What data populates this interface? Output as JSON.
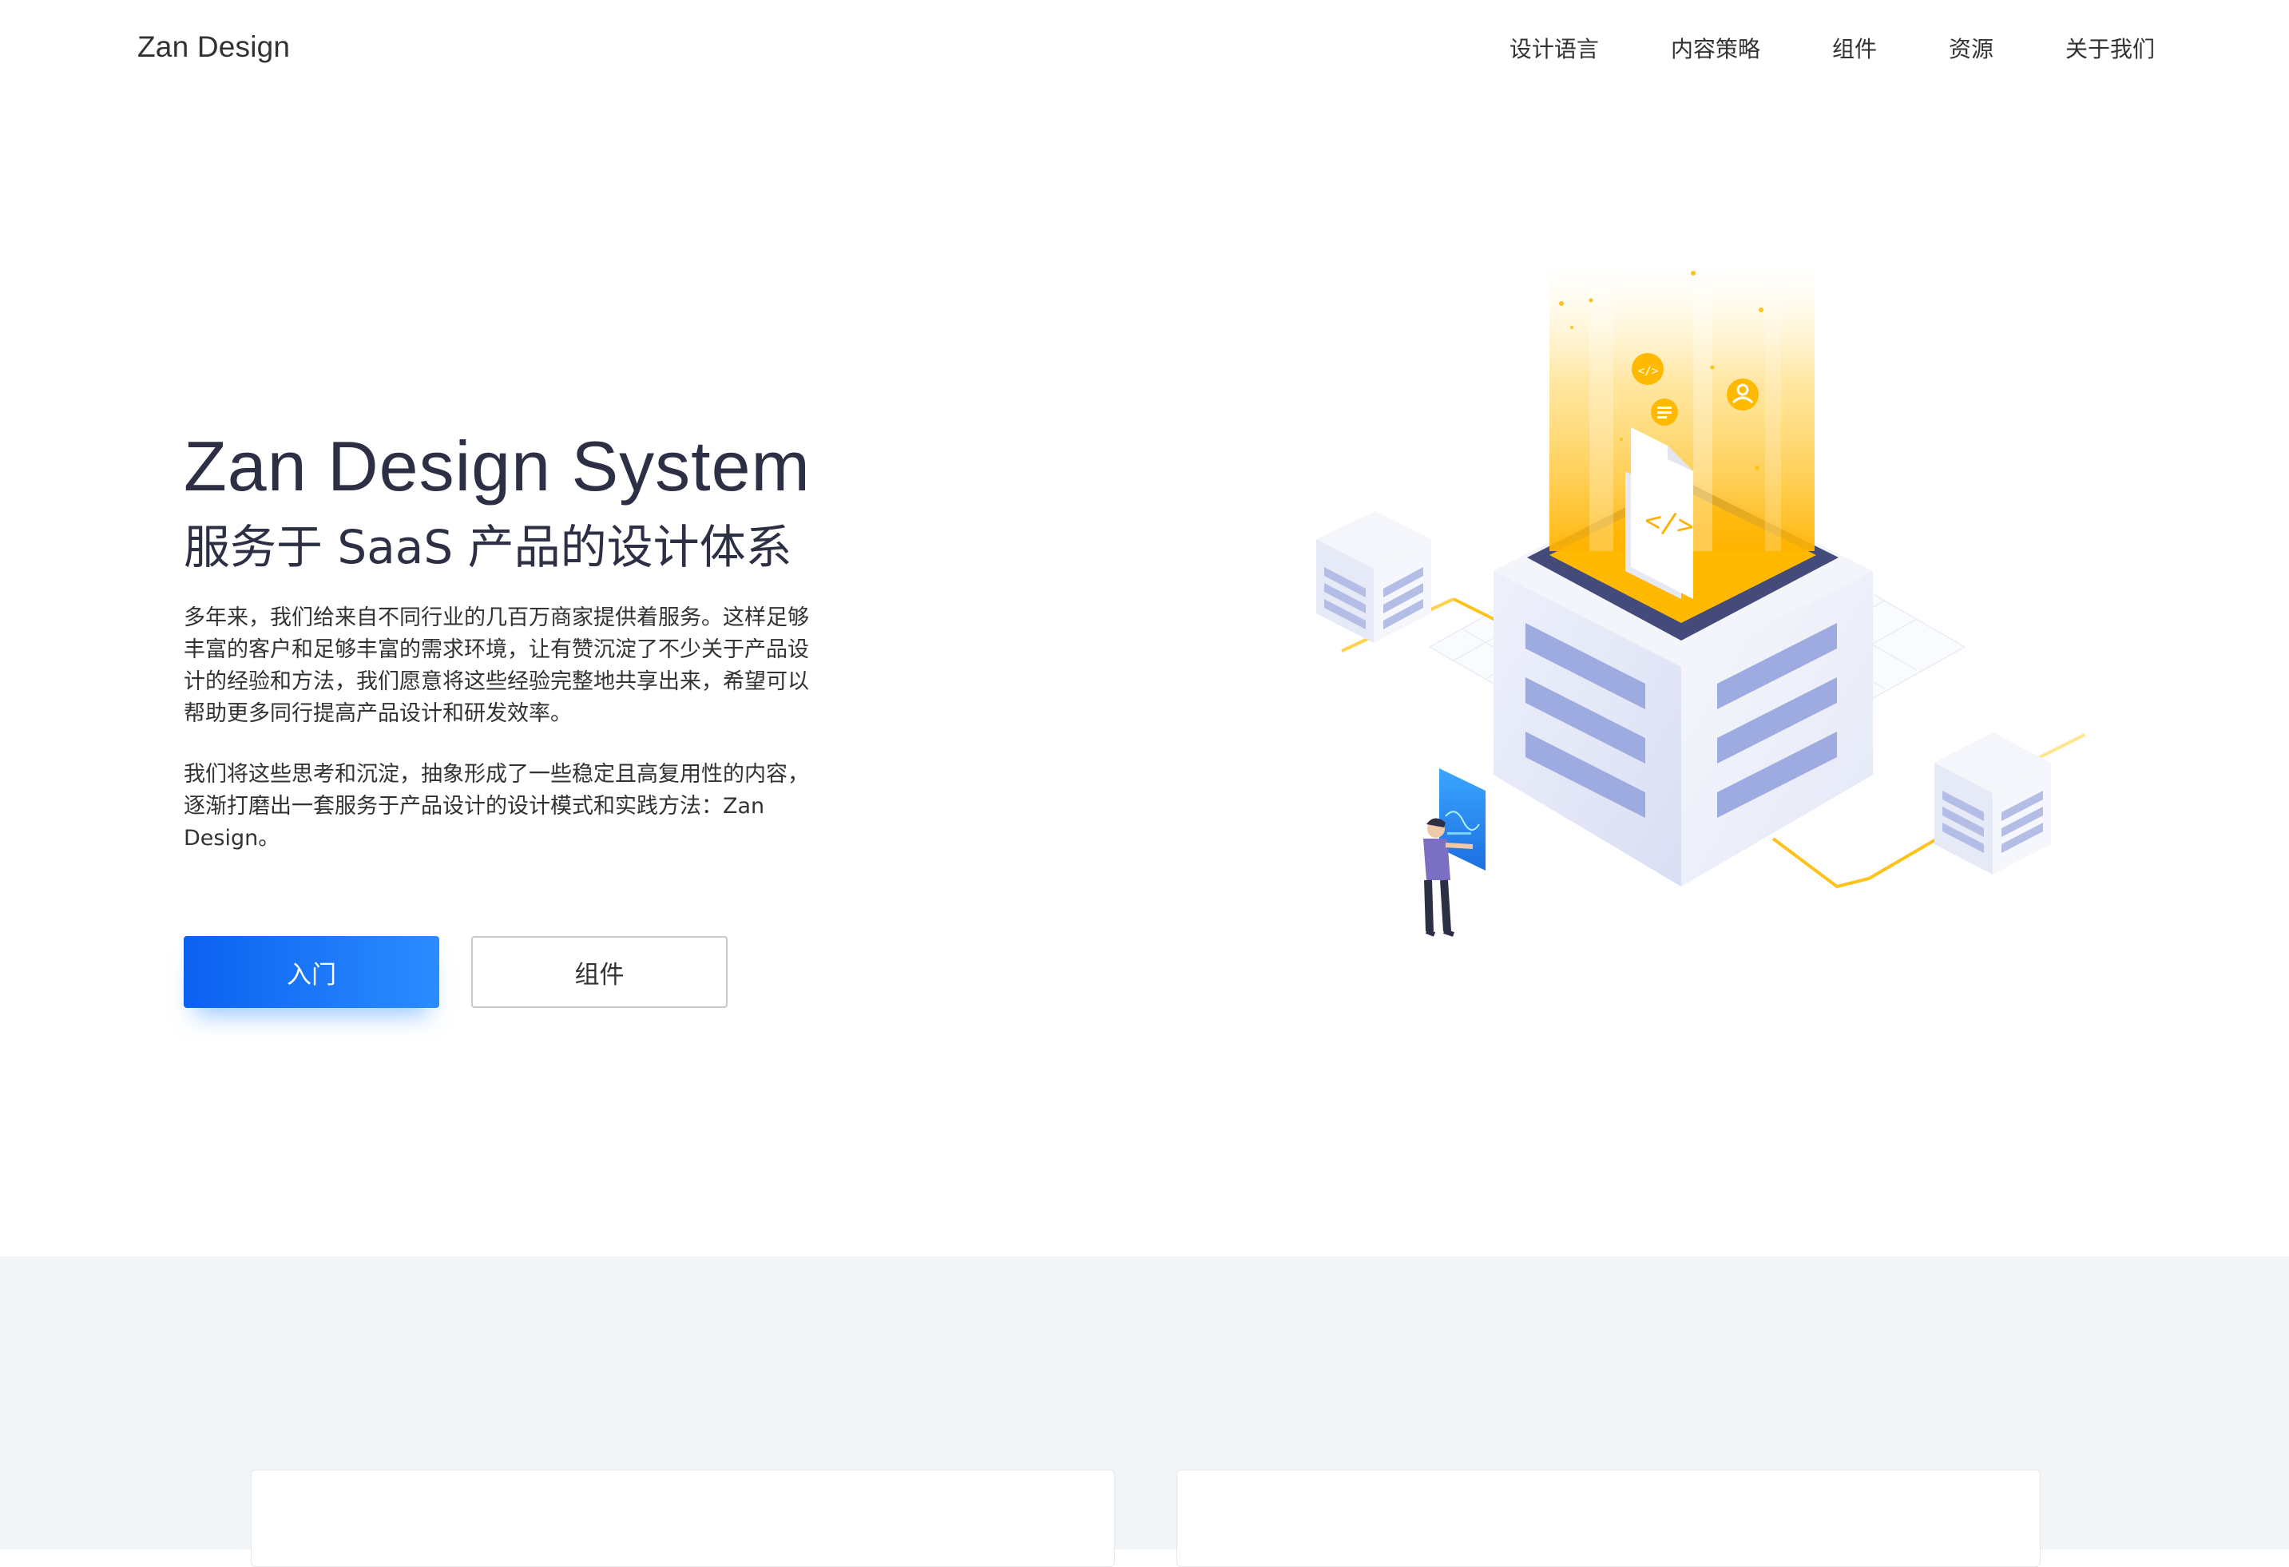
{
  "header": {
    "logo": "Zan Design",
    "nav": [
      "设计语言",
      "内容策略",
      "组件",
      "资源",
      "关于我们"
    ]
  },
  "hero": {
    "title_en": "Zan Design System",
    "title_cn": "服务于 SaaS 产品的设计体系",
    "paragraph1": "多年来，我们给来自不同行业的几百万商家提供着服务。这样足够丰富的客户和足够丰富的需求环境，让有赞沉淀了不少关于产品设计的经验和方法，我们愿意将这些经验完整地共享出来，希望可以帮助更多同行提高产品设计和研发效率。",
    "paragraph2": "我们将这些思考和沉淀，抽象形成了一些稳定且高复用性的内容，逐渐打磨出一套服务于产品设计的设计模式和实践方法：Zan Design。",
    "primary_button": "入门",
    "secondary_button": "组件"
  },
  "colors": {
    "brand_blue": "#1570ef",
    "accent_yellow": "#ffc21a",
    "heading": "#2d2f45"
  }
}
